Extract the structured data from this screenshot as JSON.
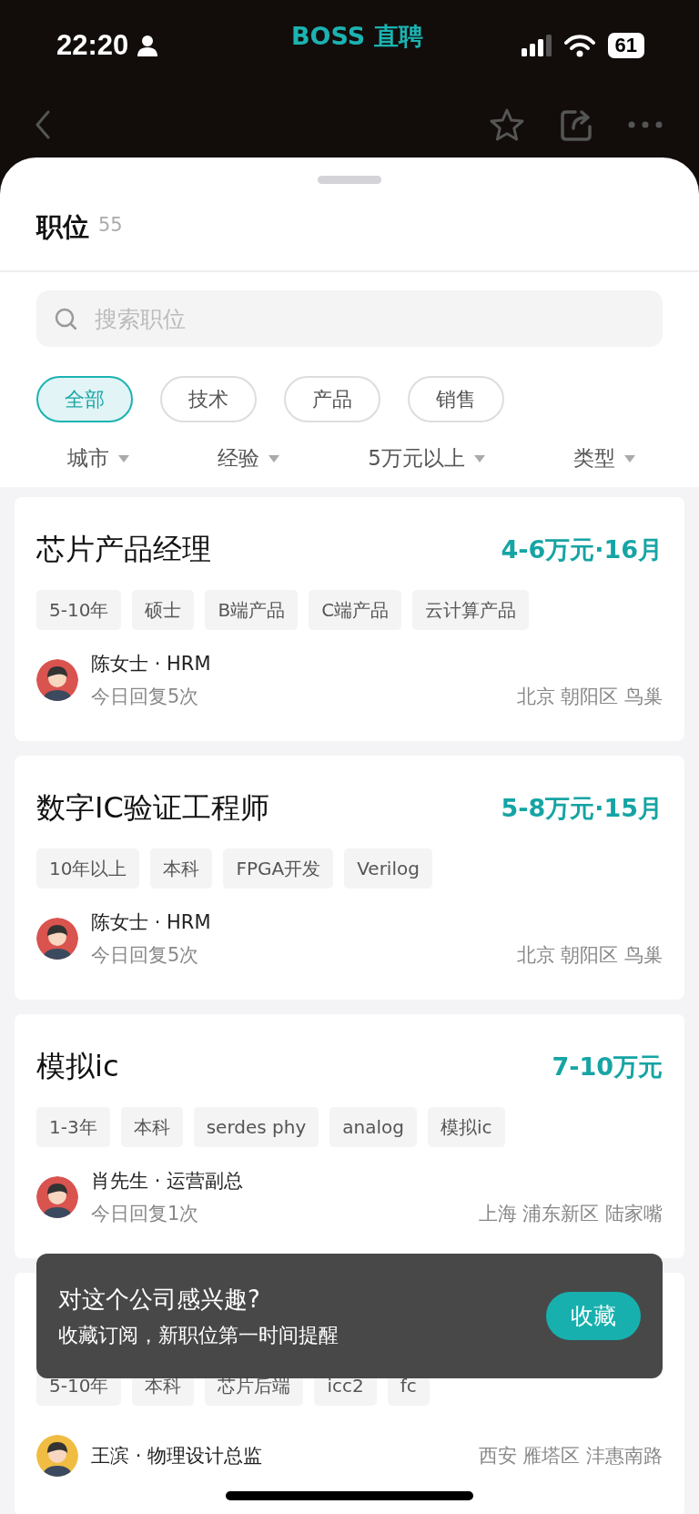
{
  "status_bar": {
    "time": "22:20",
    "app_name": "BOSS 直聘",
    "battery": "61"
  },
  "header": {
    "title": "职位",
    "count": "55"
  },
  "search": {
    "placeholder": "搜索职位"
  },
  "categories": [
    {
      "label": "全部",
      "selected": true
    },
    {
      "label": "技术",
      "selected": false
    },
    {
      "label": "产品",
      "selected": false
    },
    {
      "label": "销售",
      "selected": false
    }
  ],
  "filters": [
    "城市",
    "经验",
    "5万元以上",
    "类型"
  ],
  "jobs": [
    {
      "title": "芯片产品经理",
      "salary": "4-6万元·16月",
      "tags": [
        "5-10年",
        "硕士",
        "B端产品",
        "C端产品",
        "云计算产品"
      ],
      "recruiter": {
        "name": "陈女士 · HRM",
        "reply": "今日回复5次",
        "color": "#d9534f"
      },
      "location": "北京 朝阳区 鸟巢"
    },
    {
      "title": "数字IC验证工程师",
      "salary": "5-8万元·15月",
      "tags": [
        "10年以上",
        "本科",
        "FPGA开发",
        "Verilog"
      ],
      "recruiter": {
        "name": "陈女士 · HRM",
        "reply": "今日回复5次",
        "color": "#d9534f"
      },
      "location": "北京 朝阳区 鸟巢"
    },
    {
      "title": "模拟ic",
      "salary": "7-10万元",
      "tags": [
        "1-3年",
        "本科",
        "serdes phy",
        "analog",
        "模拟ic"
      ],
      "recruiter": {
        "name": "肖先生 · 运营副总",
        "reply": "今日回复1次",
        "color": "#d9534f"
      },
      "location": "上海 浦东新区 陆家嘴"
    },
    {
      "tags": [
        "5-10年",
        "本科",
        "芯片后端",
        "icc2",
        "fc"
      ],
      "recruiter": {
        "name": "王滨 · 物理设计总监",
        "color": "#f0bc42"
      },
      "location": "西安 雁塔区 沣惠南路"
    }
  ],
  "toast": {
    "title": "对这个公司感兴趣?",
    "message": "收藏订阅，新职位第一时间提醒",
    "button": "收藏"
  }
}
